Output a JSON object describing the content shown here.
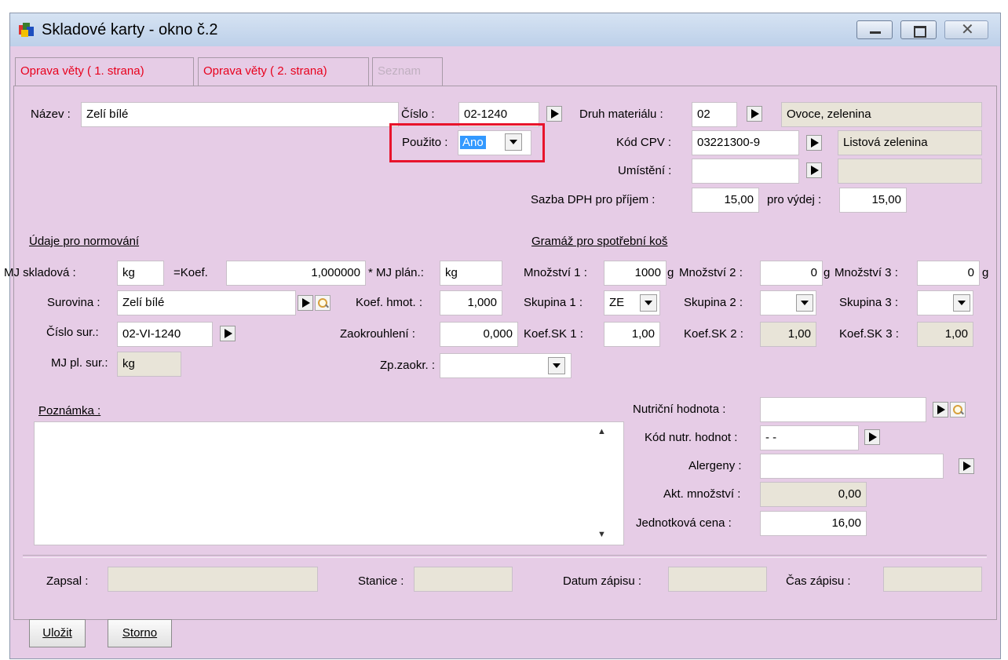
{
  "window": {
    "title": "Skladové karty - okno č.2"
  },
  "tabs": [
    "Oprava věty ( 1. strana)",
    "Oprava věty ( 2. strana)",
    "Seznam"
  ],
  "fields": {
    "nazev_label": "Název :",
    "nazev": "Zelí bílé",
    "cislo_label": "Číslo :",
    "cislo": "02-1240",
    "pouzito_label": "Použito :",
    "pouzito": "Ano",
    "druh_label": "Druh materiálu :",
    "druh": "02",
    "druh_text": "Ovoce, zelenina",
    "cpv_label": "Kód CPV :",
    "cpv": "03221300-9",
    "cpv_text": "Listová zelenina",
    "umisteni_label": "Umístění :",
    "umisteni": "",
    "umisteni_text": "",
    "dph_prijem_label": "Sazba DPH pro příjem :",
    "dph_prijem": "15,00",
    "dph_vydej_label": "pro výdej :",
    "dph_vydej": "15,00"
  },
  "normovani": {
    "heading": "Údaje pro normování",
    "mj_sklad_label": "MJ skladová :",
    "mj_sklad": "kg",
    "koef_label": "=Koef.",
    "koef": "1,000000",
    "mj_plan_label": "* MJ plán.:",
    "mj_plan": "kg",
    "surovina_label": "Surovina :",
    "surovina": "Zelí bílé",
    "koef_hmot_label": "Koef. hmot. :",
    "koef_hmot": "1,000",
    "cislo_sur_label": "Číslo sur.:",
    "cislo_sur": "02-VI-1240",
    "zaokrouhleni_label": "Zaokrouhlení :",
    "zaokrouhleni": "0,000",
    "mj_pl_sur_label": "MJ pl. sur.:",
    "mj_pl_sur": "kg",
    "zp_zaokr_label": "Zp.zaokr. :",
    "zp_zaokr": ""
  },
  "gramaz": {
    "heading": "Gramáž pro spotřební koš",
    "mnozstvi1_label": "Množství 1 :",
    "mnozstvi1": "1000",
    "mnozstvi2_label": "Množství 2 :",
    "mnozstvi2": "0",
    "mnozstvi3_label": "Množství 3 :",
    "mnozstvi3": "0",
    "unit": "g",
    "skupina1_label": "Skupina 1 :",
    "skupina1": "ZE",
    "skupina2_label": "Skupina 2 :",
    "skupina2": "",
    "skupina3_label": "Skupina 3 :",
    "skupina3": "",
    "koefsk1_label": "Koef.SK 1 :",
    "koefsk1": "1,00",
    "koefsk2_label": "Koef.SK 2 :",
    "koefsk2": "1,00",
    "koefsk3_label": "Koef.SK 3 :",
    "koefsk3": "1,00"
  },
  "poznamka": {
    "label": "Poznámka :",
    "value": ""
  },
  "nutri": {
    "nutricni_label": "Nutriční hodnota :",
    "nutricni": "",
    "kod_nutr_label": "Kód nutr. hodnot :",
    "kod_nutr": "- -",
    "alergeny_label": "Alergeny :",
    "alergeny": "",
    "akt_mn_label": "Akt. množství :",
    "akt_mn": "0,00",
    "cena_label": "Jednotková cena :",
    "cena": "16,00"
  },
  "footer": {
    "zapsal_label": "Zapsal :",
    "zapsal": "",
    "stanice_label": "Stanice :",
    "stanice": "",
    "datum_label": "Datum zápisu :",
    "datum": "",
    "cas_label": "Čas zápisu :",
    "cas": ""
  },
  "buttons": {
    "save": "Uložit",
    "cancel": "Storno"
  },
  "colors": {
    "background": "#e6cce6",
    "tab_text": "#e8001c",
    "highlight": "#e8142c",
    "selection": "#3399ff"
  }
}
